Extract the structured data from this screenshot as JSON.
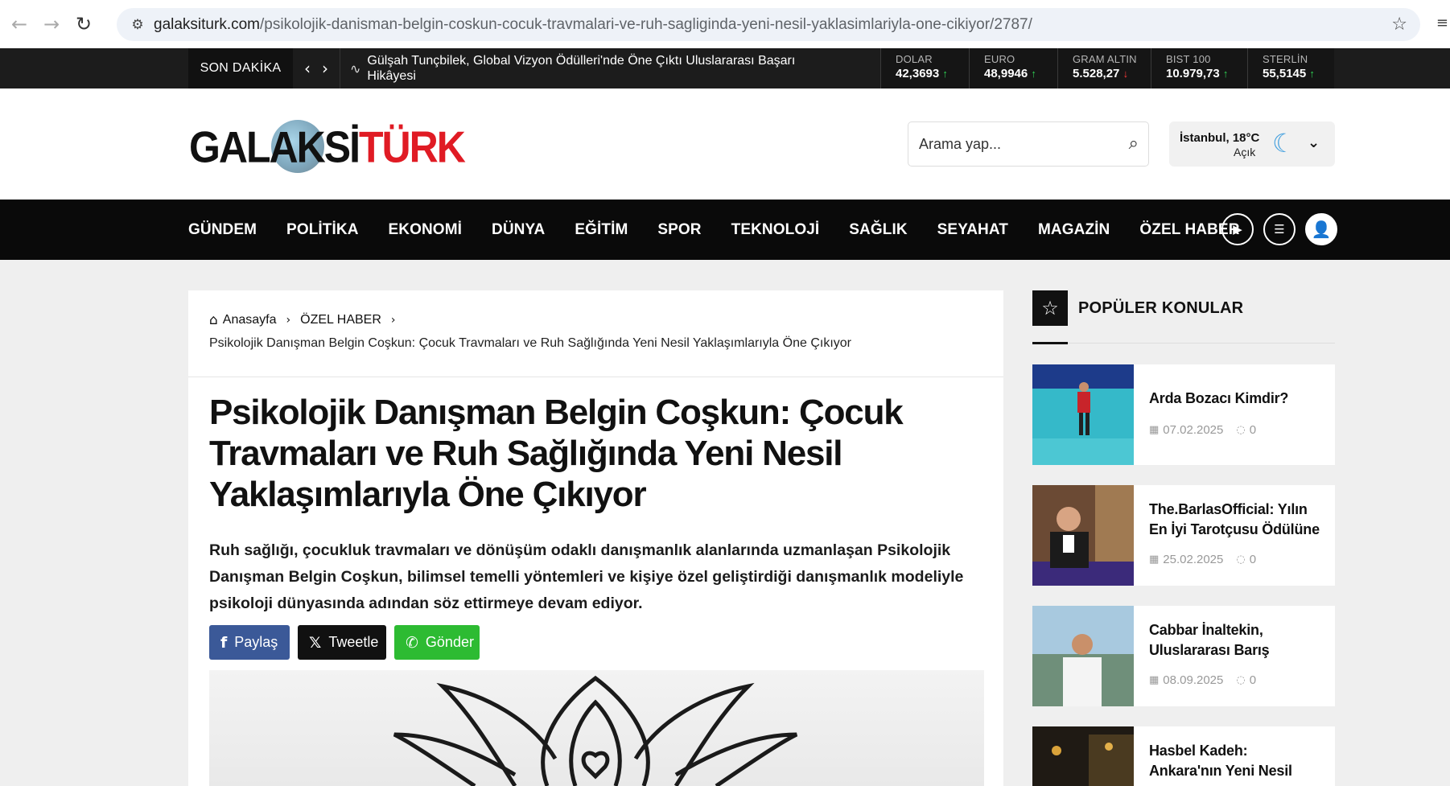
{
  "browser": {
    "url_domain": "galaksiturk.com",
    "url_path": "/psikolojik-danisman-belgin-coskun-cocuk-travmalari-ve-ruh-sagliginda-yeni-nesil-yaklasimlariyla-one-cikiyor/2787/"
  },
  "ticker": {
    "label": "SON DAKİKA",
    "headline": "Gülşah Tunçbilek, Global Vizyon Ödülleri'nde Öne Çıktı Uluslararası Başarı Hikâyesi",
    "markets": [
      {
        "label": "DOLAR",
        "value": "42,3693",
        "trend": "↑"
      },
      {
        "label": "EURO",
        "value": "48,9946",
        "trend": "↑"
      },
      {
        "label": "GRAM ALTIN",
        "value": "5.528,27",
        "trend": "↓"
      },
      {
        "label": "BIST 100",
        "value": "10.979,73",
        "trend": "↑"
      },
      {
        "label": "STERLİN",
        "value": "55,5145",
        "trend": "↑"
      }
    ]
  },
  "header": {
    "logo_left": "GALAKSİ",
    "logo_right": "TÜRK",
    "search_placeholder": "Arama yap...",
    "weather_city": "İstanbul, 18°C",
    "weather_condition": "Açık"
  },
  "nav": {
    "items": [
      "GÜNDEM",
      "POLİTİKA",
      "EKONOMİ",
      "DÜNYA",
      "EĞİTİM",
      "SPOR",
      "TEKNOLOJİ",
      "SAĞLIK",
      "SEYAHAT",
      "MAGAZİN",
      "ÖZEL HABER"
    ]
  },
  "article": {
    "breadcrumb_home": "Anasayfa",
    "breadcrumb_category": "ÖZEL HABER",
    "breadcrumb_current": "Psikolojik Danışman Belgin Coşkun: Çocuk Travmaları ve Ruh Sağlığında Yeni Nesil Yaklaşımlarıyla Öne Çıkıyor",
    "title": "Psikolojik Danışman Belgin Coşkun: Çocuk Travmaları ve Ruh Sağlığında Yeni Nesil Yaklaşımlarıyla Öne Çıkıyor",
    "lead": "Ruh sağlığı, çocukluk travmaları ve dönüşüm odaklı danışmanlık alanlarında uzmanlaşan Psikolojik Danışman Belgin Coşkun, bilimsel temelli yöntemleri ve kişiye özel geliştirdiği danışmanlık modeliyle psikoloji dünyasında adından söz ettirmeye devam ediyor.",
    "share_facebook": "Paylaş",
    "share_x": "Tweetle",
    "share_whatsapp": "Gönder"
  },
  "sidebar": {
    "title": "POPÜLER KONULAR",
    "items": [
      {
        "title": "Arda Bozacı Kimdir?",
        "date": "07.02.2025",
        "comments": "0"
      },
      {
        "title": "The.BarlasOfficial: Yılın En İyi Tarotçusu Ödülüne",
        "date": "25.02.2025",
        "comments": "0"
      },
      {
        "title": "Cabbar İnaltekin, Uluslararası Barış",
        "date": "08.09.2025",
        "comments": "0"
      },
      {
        "title": "Hasbel Kadeh: Ankara'nın Yeni Nesil",
        "date": "",
        "comments": ""
      }
    ]
  }
}
